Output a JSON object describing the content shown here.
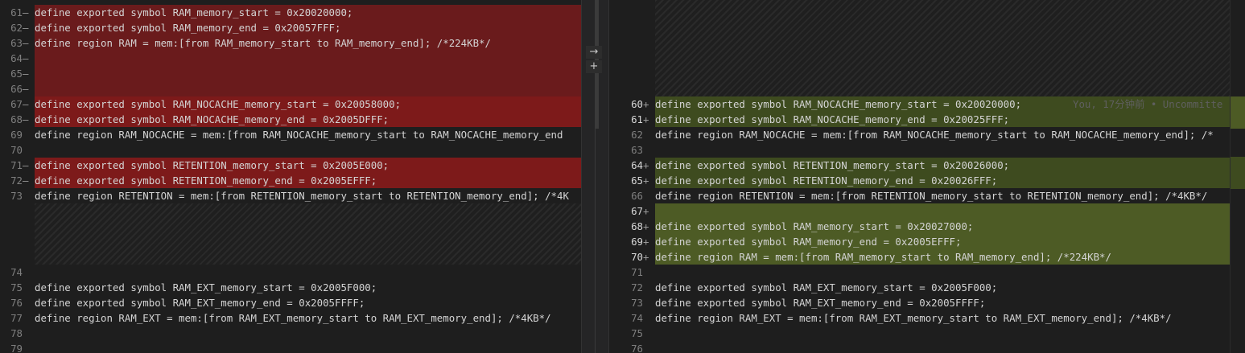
{
  "left": {
    "lines": [
      {
        "n": "61",
        "m": "—",
        "t": "define exported symbol RAM_memory_start = 0x20020000;",
        "kind": "del"
      },
      {
        "n": "62",
        "m": "—",
        "t": "define exported symbol RAM_memory_end = 0x20057FFF;",
        "kind": "del"
      },
      {
        "n": "63",
        "m": "—",
        "t": "define region RAM = mem:[from RAM_memory_start to RAM_memory_end]; /*224KB*/",
        "kind": "del"
      },
      {
        "n": "64",
        "m": "—",
        "t": "",
        "kind": "del"
      },
      {
        "n": "65",
        "m": "—",
        "t": "",
        "kind": "del"
      },
      {
        "n": "66",
        "m": "—",
        "t": "",
        "kind": "del"
      },
      {
        "n": "67",
        "m": "—",
        "t": "define exported symbol RAM_NOCACHE_memory_start = 0x20058000;",
        "kind": "delstrong"
      },
      {
        "n": "68",
        "m": "—",
        "t": "define exported symbol RAM_NOCACHE_memory_end = 0x2005DFFF;",
        "kind": "delstrong"
      },
      {
        "n": "69",
        "m": "",
        "t": "define region RAM_NOCACHE = mem:[from RAM_NOCACHE_memory_start to RAM_NOCACHE_memory_end",
        "kind": ""
      },
      {
        "n": "70",
        "m": "",
        "t": "",
        "kind": ""
      },
      {
        "n": "71",
        "m": "—",
        "t": "define exported symbol RETENTION_memory_start = 0x2005E000;",
        "kind": "delstrong"
      },
      {
        "n": "72",
        "m": "—",
        "t": "define exported symbol RETENTION_memory_end = 0x2005EFFF;",
        "kind": "delstrong"
      },
      {
        "n": "73",
        "m": "",
        "t": "define region RETENTION = mem:[from RETENTION_memory_start to RETENTION_memory_end]; /*4K",
        "kind": ""
      },
      {
        "n": "74",
        "m": "",
        "t": "",
        "kind": ""
      },
      {
        "n": "75",
        "m": "",
        "t": "define exported symbol RAM_EXT_memory_start = 0x2005F000;",
        "kind": ""
      },
      {
        "n": "76",
        "m": "",
        "t": "define exported symbol RAM_EXT_memory_end = 0x2005FFFF;",
        "kind": ""
      },
      {
        "n": "77",
        "m": "",
        "t": "define region RAM_EXT = mem:[from RAM_EXT_memory_start to RAM_EXT_memory_end]; /*4KB*/",
        "kind": ""
      },
      {
        "n": "78",
        "m": "",
        "t": "",
        "kind": ""
      },
      {
        "n": "79",
        "m": "",
        "t": "",
        "kind": ""
      }
    ]
  },
  "right": {
    "lines": [
      {
        "n": "60",
        "m": "+",
        "t": "define exported symbol RAM_NOCACHE_memory_start = 0x20020000;",
        "kind": "add",
        "blame": "You, 17分钟前 • Uncommitte"
      },
      {
        "n": "61",
        "m": "+",
        "t": "define exported symbol RAM_NOCACHE_memory_end = 0x20025FFF;",
        "kind": "add"
      },
      {
        "n": "62",
        "m": "",
        "t": "define region RAM_NOCACHE = mem:[from RAM_NOCACHE_memory_start to RAM_NOCACHE_memory_end]; /*",
        "kind": ""
      },
      {
        "n": "63",
        "m": "",
        "t": "",
        "kind": ""
      },
      {
        "n": "64",
        "m": "+",
        "t": "define exported symbol RETENTION_memory_start = 0x20026000;",
        "kind": "add"
      },
      {
        "n": "65",
        "m": "+",
        "t": "define exported symbol RETENTION_memory_end = 0x20026FFF;",
        "kind": "add"
      },
      {
        "n": "66",
        "m": "",
        "t": "define region RETENTION = mem:[from RETENTION_memory_start to RETENTION_memory_end]; /*4KB*/",
        "kind": ""
      },
      {
        "n": "67",
        "m": "+",
        "t": "",
        "kind": "addstrong"
      },
      {
        "n": "68",
        "m": "+",
        "t": "define exported symbol RAM_memory_start = 0x20027000;",
        "kind": "addstrong"
      },
      {
        "n": "69",
        "m": "+",
        "t": "define exported symbol RAM_memory_end = 0x2005EFFF;",
        "kind": "addstrong"
      },
      {
        "n": "70",
        "m": "+",
        "t": "define region RAM = mem:[from RAM_memory_start to RAM_memory_end]; /*224KB*/",
        "kind": "addstrong"
      },
      {
        "n": "71",
        "m": "",
        "t": "",
        "kind": ""
      },
      {
        "n": "72",
        "m": "",
        "t": "define exported symbol RAM_EXT_memory_start = 0x2005F000;",
        "kind": ""
      },
      {
        "n": "73",
        "m": "",
        "t": "define exported symbol RAM_EXT_memory_end = 0x2005FFFF;",
        "kind": ""
      },
      {
        "n": "74",
        "m": "",
        "t": "define region RAM_EXT = mem:[from RAM_EXT_memory_start to RAM_EXT_memory_end]; /*4KB*/",
        "kind": ""
      },
      {
        "n": "75",
        "m": "",
        "t": "",
        "kind": ""
      },
      {
        "n": "76",
        "m": "",
        "t": "",
        "kind": ""
      }
    ]
  },
  "actions": {
    "revert_icon": "→",
    "stage_icon": "+"
  },
  "colors": {
    "deleted": "#6a1b1c",
    "added": "#3e4b1f",
    "added_strong": "#4d5b25"
  }
}
